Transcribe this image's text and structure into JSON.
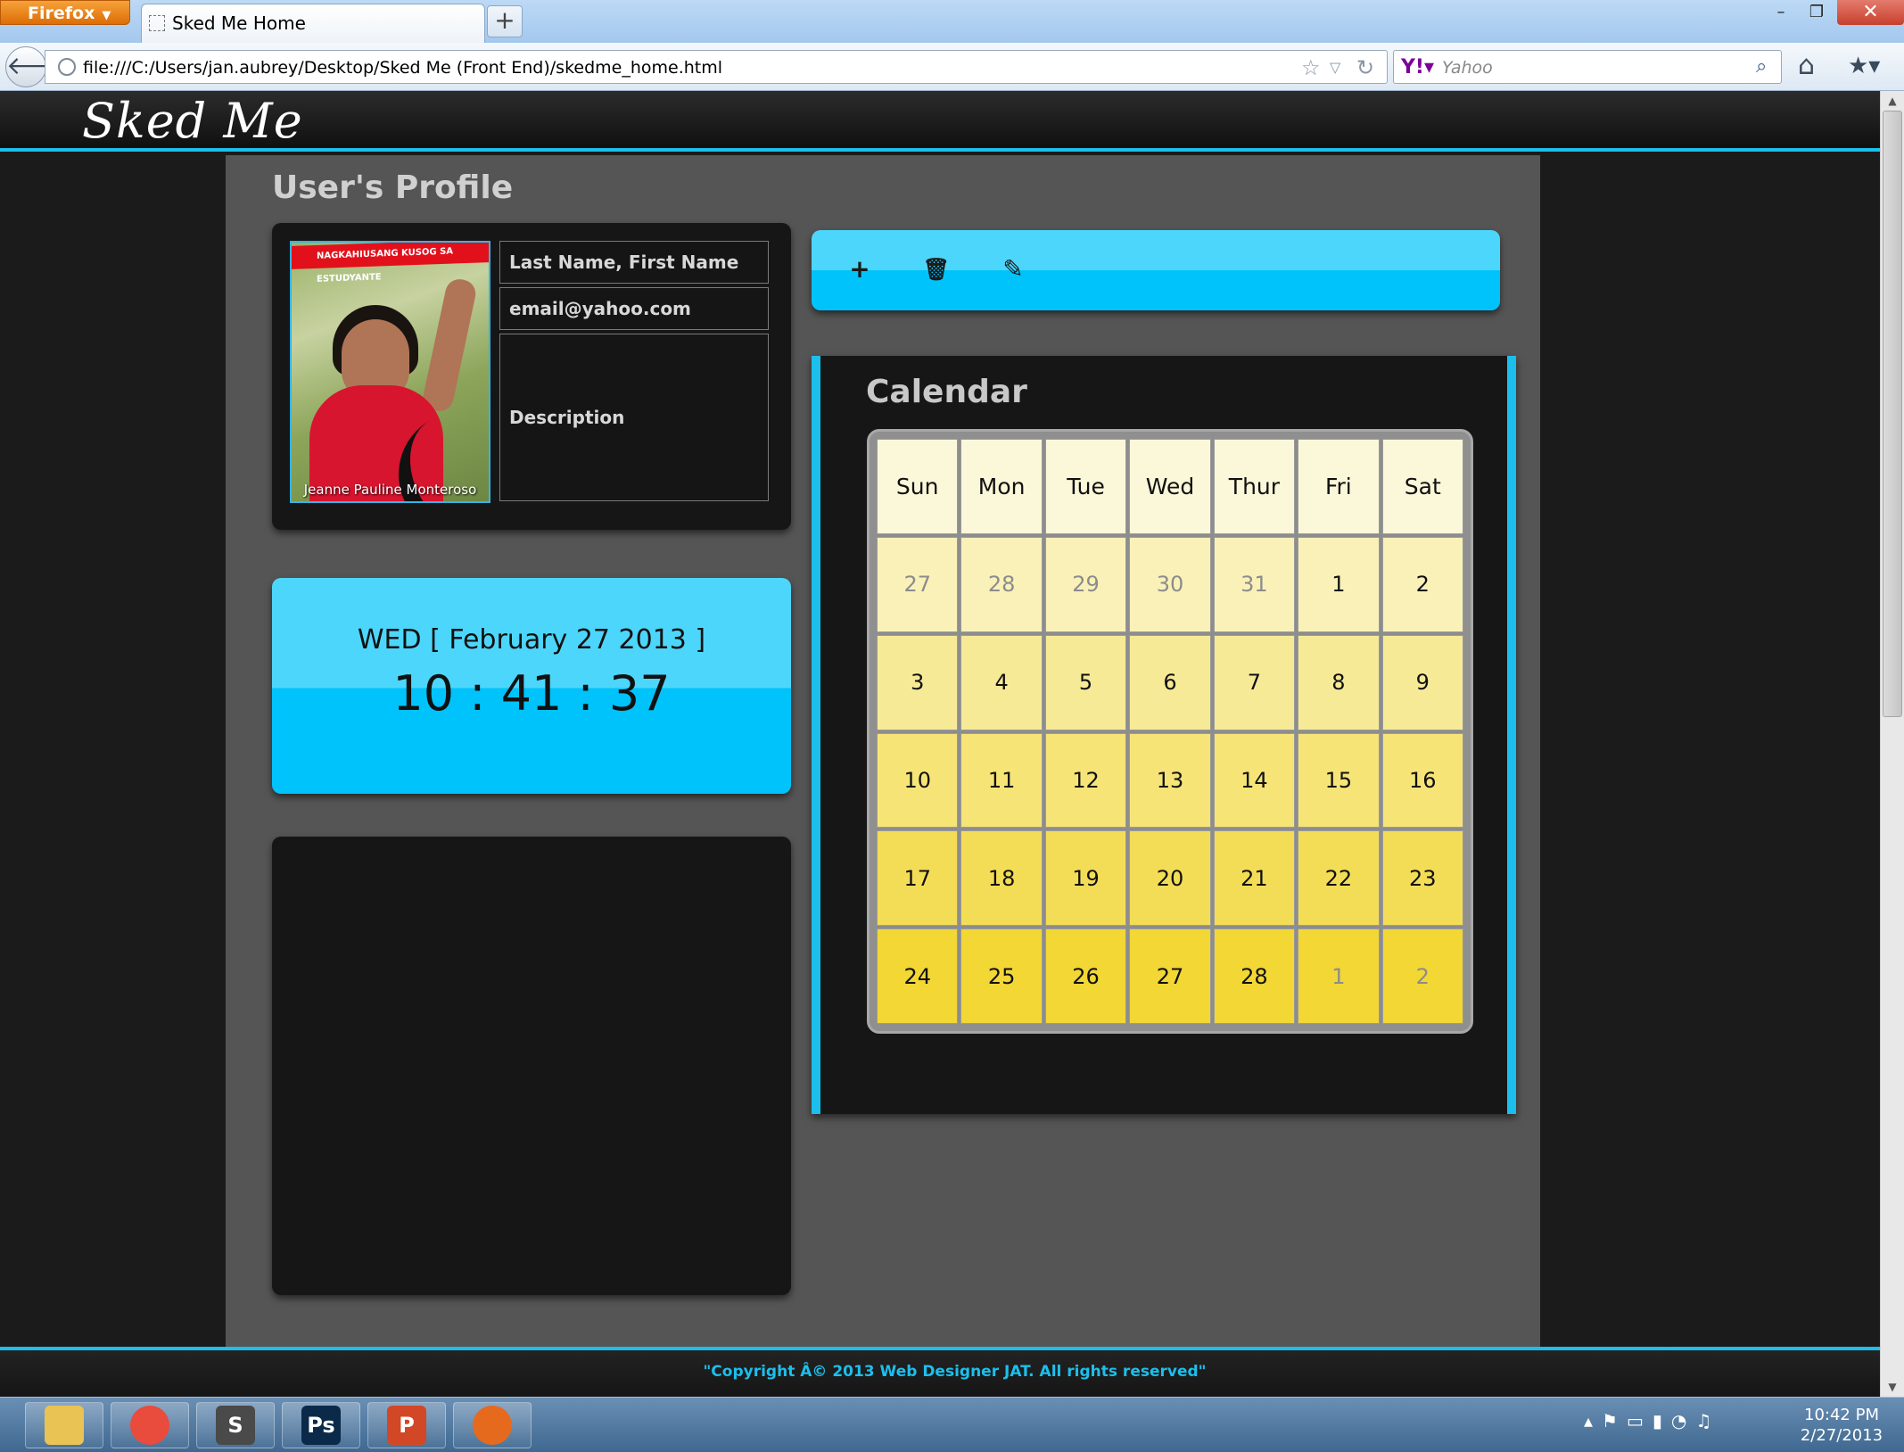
{
  "browser": {
    "menu_button": "Firefox",
    "tab_title": "Sked Me Home",
    "new_tab": "+",
    "url": "file:///C:/Users/jan.aubrey/Desktop/Sked Me (Front End)/skedme_home.html",
    "search_placeholder": "Yahoo",
    "window_controls": {
      "minimize": "–",
      "restore": "❐",
      "close": "✕"
    }
  },
  "site": {
    "logo": "Sked Me",
    "profile_title": "User's Profile",
    "profile": {
      "photo_caption": "Jeanne Pauline Monteroso",
      "photo_banner": "NAGKAHIUSANG KUSOG SA ESTUDYANTE",
      "name": "Last Name, First Name",
      "email": "email@yahoo.com",
      "description": "Description"
    },
    "clock": {
      "date": "WED [ February 27 2013 ]",
      "time": "10 : 41 : 37"
    },
    "toolbar": {
      "add": "+",
      "delete": "🗑",
      "edit": "✎"
    },
    "calendar": {
      "title": "Calendar",
      "days": [
        "Sun",
        "Mon",
        "Tue",
        "Wed",
        "Thur",
        "Fri",
        "Sat"
      ],
      "weeks": [
        [
          "27",
          "28",
          "29",
          "30",
          "31",
          "1",
          "2"
        ],
        [
          "3",
          "4",
          "5",
          "6",
          "7",
          "8",
          "9"
        ],
        [
          "10",
          "11",
          "12",
          "13",
          "14",
          "15",
          "16"
        ],
        [
          "17",
          "18",
          "19",
          "20",
          "21",
          "22",
          "23"
        ],
        [
          "24",
          "25",
          "26",
          "27",
          "28",
          "1",
          "2"
        ]
      ],
      "muted": [
        [
          true,
          true,
          true,
          true,
          true,
          false,
          false
        ],
        [
          false,
          false,
          false,
          false,
          false,
          false,
          false
        ],
        [
          false,
          false,
          false,
          false,
          false,
          false,
          false
        ],
        [
          false,
          false,
          false,
          false,
          false,
          false,
          false
        ],
        [
          false,
          false,
          false,
          false,
          false,
          true,
          true
        ]
      ]
    },
    "footer": "\"Copyright Â© 2013 Web Designer JAT. All rights reserved\""
  },
  "taskbar": {
    "apps": [
      {
        "name": "file-explorer-icon",
        "label": "",
        "color": "#e9c354"
      },
      {
        "name": "chrome-icon",
        "label": "",
        "color": "#e94b3c"
      },
      {
        "name": "sublime-text-icon",
        "label": "S",
        "color": "#4a4a4a"
      },
      {
        "name": "photoshop-icon",
        "label": "Ps",
        "color": "#0b2a4a"
      },
      {
        "name": "powerpoint-icon",
        "label": "P",
        "color": "#d24726"
      },
      {
        "name": "firefox-icon",
        "label": "",
        "color": "#e66a1e"
      }
    ],
    "time": "10:42 PM",
    "date": "2/27/2013"
  },
  "colors": {
    "accent": "#1cbfec",
    "calendar_top": "#fbf7d9",
    "calendar_bottom": "#f2d735"
  }
}
